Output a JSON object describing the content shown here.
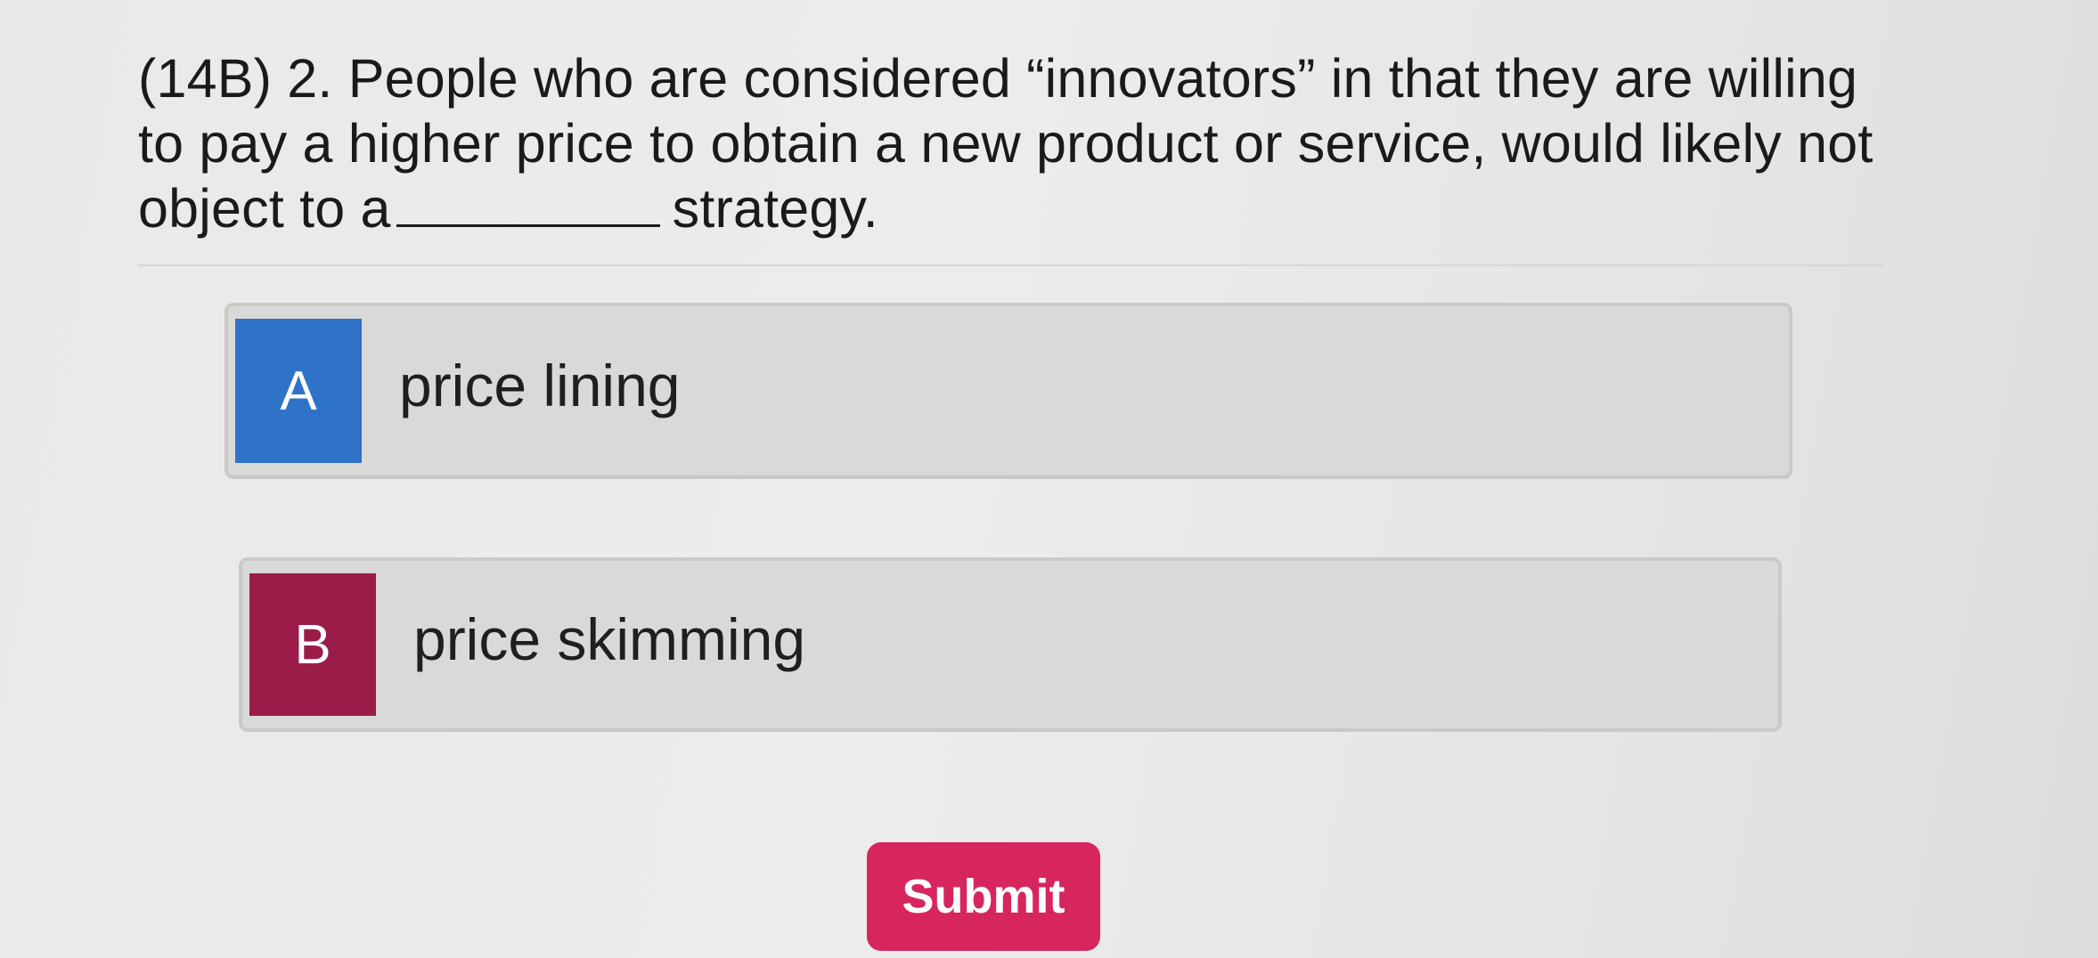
{
  "question": {
    "before_blank": "(14B) 2. People who are considered “innovators” in that they are willing to pay a higher price to obtain a new product or service, would likely not object to a",
    "after_blank": "strategy."
  },
  "options": [
    {
      "letter": "A",
      "text": "price lining",
      "color": "#2f73c9"
    },
    {
      "letter": "B",
      "text": "price skimming",
      "color": "#9b1c49"
    }
  ],
  "submit": {
    "label": "Submit",
    "color": "#d7255e"
  }
}
